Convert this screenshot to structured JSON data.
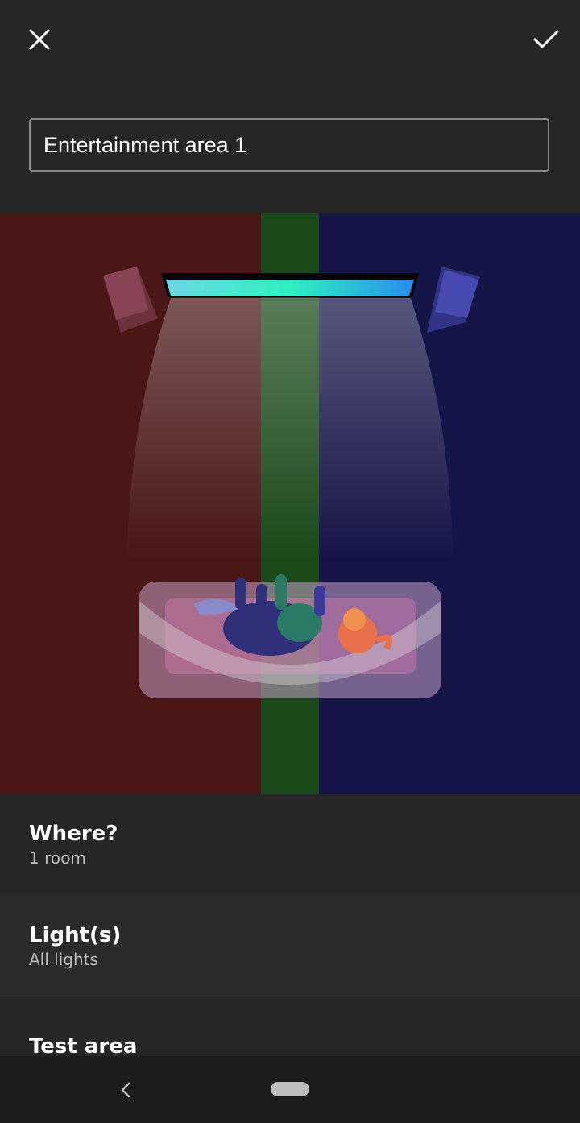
{
  "header": {
    "close_icon": "close-icon",
    "confirm_icon": "checkmark-icon"
  },
  "area_name": {
    "value": "Entertainment area 1"
  },
  "illustration": {
    "zones": [
      "#4a1616",
      "#1b4a1a",
      "#161548"
    ]
  },
  "settings": {
    "where": {
      "title": "Where?",
      "subtitle": "1 room"
    },
    "lights": {
      "title": "Light(s)",
      "subtitle": "All lights"
    },
    "test": {
      "title": "Test area"
    }
  },
  "navbar": {
    "back_icon": "chevron-left-icon",
    "home_icon": "home-pill-icon"
  }
}
